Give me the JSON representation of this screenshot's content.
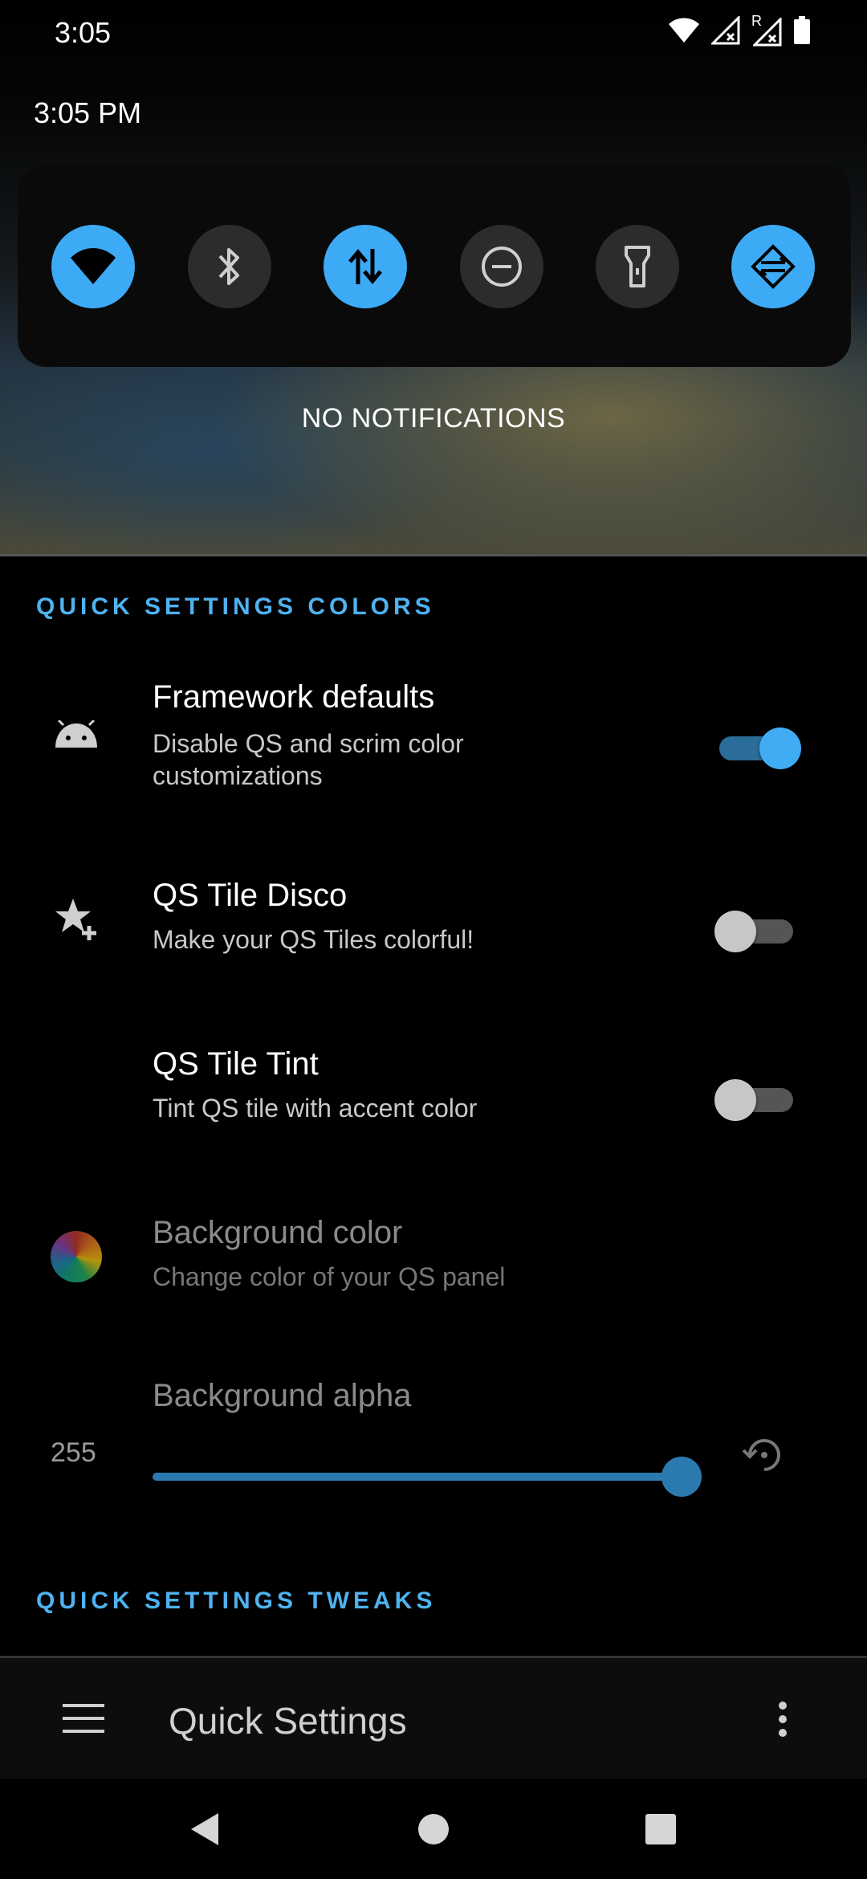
{
  "status_bar": {
    "time": "3:05",
    "icons": [
      "wifi-icon",
      "signal-x-icon",
      "roaming-signal-x-icon",
      "battery-icon"
    ],
    "roaming_letter": "R"
  },
  "shade": {
    "clock": "3:05 PM",
    "tiles": [
      {
        "name": "wifi",
        "icon": "wifi-icon",
        "state": "on"
      },
      {
        "name": "bluetooth",
        "icon": "bluetooth-icon",
        "state": "off"
      },
      {
        "name": "mobile-data",
        "icon": "data-arrows-icon",
        "state": "on"
      },
      {
        "name": "do-not-disturb",
        "icon": "dnd-icon",
        "state": "off"
      },
      {
        "name": "flashlight",
        "icon": "flashlight-icon",
        "state": "off"
      },
      {
        "name": "auto-rotate",
        "icon": "rotate-icon",
        "state": "on"
      }
    ],
    "no_notifications": "NO NOTIFICATIONS"
  },
  "sections": {
    "colors_header": "QUICK SETTINGS COLORS",
    "tweaks_header": "QUICK SETTINGS TWEAKS"
  },
  "settings": {
    "framework_defaults": {
      "title": "Framework defaults",
      "subtitle": "Disable QS and scrim color customizations",
      "enabled": true,
      "icon": "android-icon"
    },
    "tile_disco": {
      "title": "QS Tile Disco",
      "subtitle": "Make your QS Tiles colorful!",
      "enabled": false,
      "icon": "star-plus-icon"
    },
    "tile_tint": {
      "title": "QS Tile Tint",
      "subtitle": "Tint QS tile with accent color",
      "enabled": false
    },
    "background_color": {
      "title": "Background color",
      "subtitle": "Change color of your QS panel",
      "icon": "color-wheel-icon"
    },
    "background_alpha": {
      "title": "Background alpha",
      "value": "255",
      "max": 255,
      "fill": 1.0,
      "reset_icon": "reset-icon"
    }
  },
  "app_bar": {
    "title": "Quick Settings",
    "menu_icon": "hamburger-menu-icon",
    "overflow_icon": "more-vert-icon"
  },
  "nav_bar": {
    "buttons": [
      "back-icon",
      "home-icon",
      "recents-icon"
    ]
  },
  "colors": {
    "accent": "#40acf4",
    "section_header": "#4fb2ef",
    "tile_on": "#3daaf5",
    "tile_off": "#2c2c2c"
  }
}
